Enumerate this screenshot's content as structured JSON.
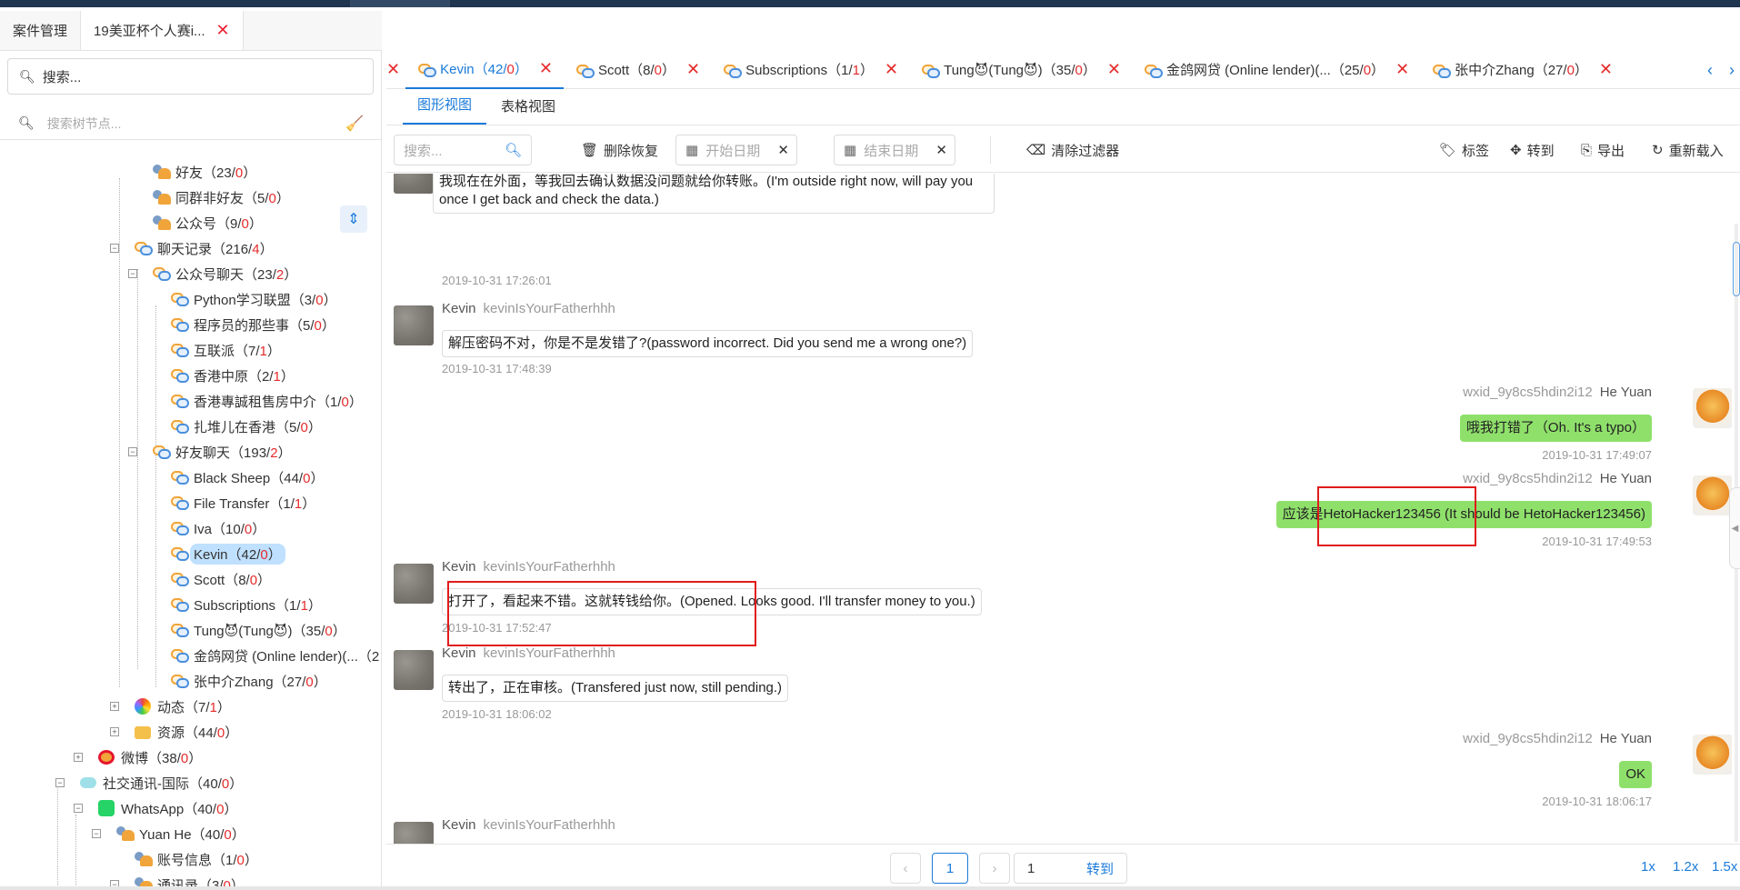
{
  "outer_tabs": [
    {
      "label": "案件管理",
      "active": false,
      "closable": false
    },
    {
      "label": "19美亚杯个人赛i...",
      "active": true,
      "closable": true
    }
  ],
  "left": {
    "search_placeholder": "搜索...",
    "tree_search_placeholder": "搜索树节点...",
    "nodes": [
      {
        "name": "好友",
        "a": "23",
        "b": "0",
        "icon": "people"
      },
      {
        "name": "同群非好友",
        "a": "5",
        "b": "0",
        "icon": "people"
      },
      {
        "name": "公众号",
        "a": "9",
        "b": "0",
        "icon": "people"
      },
      {
        "name": "聊天记录",
        "a": "216",
        "b": "4",
        "icon": "chat"
      },
      {
        "name": "公众号聊天",
        "a": "23",
        "b": "2",
        "icon": "chat"
      },
      {
        "name": "Python学习联盟",
        "a": "3",
        "b": "0",
        "icon": "chat"
      },
      {
        "name": "程序员的那些事",
        "a": "5",
        "b": "0",
        "icon": "chat"
      },
      {
        "name": "互联派",
        "a": "7",
        "b": "1",
        "icon": "chat"
      },
      {
        "name": "香港中原",
        "a": "2",
        "b": "1",
        "icon": "chat"
      },
      {
        "name": "香港專誠租售房中介",
        "a": "1",
        "b": "0",
        "icon": "chat"
      },
      {
        "name": "扎堆儿在香港",
        "a": "5",
        "b": "0",
        "icon": "chat"
      },
      {
        "name": "好友聊天",
        "a": "193",
        "b": "2",
        "icon": "chat"
      },
      {
        "name": "Black Sheep",
        "a": "44",
        "b": "0",
        "icon": "chat"
      },
      {
        "name": "File Transfer",
        "a": "1",
        "b": "1",
        "icon": "chat"
      },
      {
        "name": "Iva",
        "a": "10",
        "b": "0",
        "icon": "chat"
      },
      {
        "name": "Kevin",
        "a": "42",
        "b": "0",
        "icon": "chat"
      },
      {
        "name": "Scott",
        "a": "8",
        "b": "0",
        "icon": "chat"
      },
      {
        "name": "Subscriptions",
        "a": "1",
        "b": "1",
        "icon": "chat"
      },
      {
        "name": "Tung😈(Tung😈)",
        "a": "35",
        "b": "0",
        "icon": "chat"
      },
      {
        "name": "金鸽网贷 (Online lender)(...",
        "a": "2",
        "b": "",
        "icon": "chat"
      },
      {
        "name": "张中介Zhang",
        "a": "27",
        "b": "0",
        "icon": "chat"
      },
      {
        "name": "动态",
        "a": "7",
        "b": "1",
        "icon": "moments"
      },
      {
        "name": "资源",
        "a": "44",
        "b": "0",
        "icon": "resource"
      },
      {
        "name": "微博",
        "a": "38",
        "b": "0",
        "icon": "weibo"
      },
      {
        "name": "社交通讯-国际",
        "a": "40",
        "b": "0",
        "icon": "intl"
      },
      {
        "name": "WhatsApp",
        "a": "40",
        "b": "0",
        "icon": "whatsapp"
      },
      {
        "name": "Yuan He",
        "a": "40",
        "b": "0",
        "icon": "user"
      },
      {
        "name": "账号信息",
        "a": "1",
        "b": "0",
        "icon": "user"
      },
      {
        "name": "通讯录",
        "a": "3",
        "b": "0",
        "icon": "people"
      }
    ]
  },
  "chat_tabs": [
    {
      "name": "Kevin",
      "a": "42",
      "b": "0",
      "active": true
    },
    {
      "name": "Scott",
      "a": "8",
      "b": "0",
      "active": false
    },
    {
      "name": "Subscriptions",
      "a": "1",
      "b": "1",
      "active": false
    },
    {
      "name": "Tung😈(Tung😈)",
      "a": "35",
      "b": "0",
      "active": false
    },
    {
      "name": "金鸽网贷 (Online lender)(...",
      "a": "25",
      "b": "0",
      "active": false
    },
    {
      "name": "张中介Zhang",
      "a": "27",
      "b": "0",
      "active": false
    }
  ],
  "view_tabs": {
    "graphic": "图形视图",
    "table": "表格视图"
  },
  "toolbar": {
    "search_placeholder": "搜索...",
    "delete_restore": "删除恢复",
    "start_date": "开始日期",
    "end_date": "结束日期",
    "clear_filters": "清除过滤器",
    "tag": "标签",
    "goto": "转到",
    "export": "导出",
    "reload": "重新载入"
  },
  "messages": [
    {
      "side": "left",
      "sender": "",
      "uid": "",
      "text": "我现在在外面，等我回去确认数据没问题就给你转账。(I'm outside  right now, will pay you",
      "text2": "once I get back and check the data.)",
      "ts": "2019-10-31 17:26:01"
    },
    {
      "side": "left",
      "sender": "Kevin",
      "uid": "kevinIsYourFatherhhh",
      "text": "解压密码不对，你是不是发错了?(password incorrect. Did you send me a wrong one?)",
      "ts": "2019-10-31 17:48:39"
    },
    {
      "side": "right",
      "sender": "He Yuan",
      "uid": "wxid_9y8cs5hdin2i12",
      "text": "哦我打错了（Oh. It's a typo）",
      "ts": "2019-10-31 17:49:07"
    },
    {
      "side": "right",
      "sender": "He Yuan",
      "uid": "wxid_9y8cs5hdin2i12",
      "text": "应该是HetoHacker123456 (It should be HetoHacker123456)",
      "ts": "2019-10-31 17:49:53"
    },
    {
      "side": "left",
      "sender": "Kevin",
      "uid": "kevinIsYourFatherhhh",
      "text": "打开了，看起来不错。这就转钱给你。(Opened. Looks good. I'll transfer money  to you.)",
      "ts": "2019-10-31 17:52:47"
    },
    {
      "side": "left",
      "sender": "Kevin",
      "uid": "kevinIsYourFatherhhh",
      "text": "转出了，正在审核。(Transfered just now, still pending.)",
      "ts": "2019-10-31 18:06:02"
    },
    {
      "side": "right",
      "sender": "He Yuan",
      "uid": "wxid_9y8cs5hdin2i12",
      "text": "OK",
      "ts": "2019-10-31 18:06:17"
    },
    {
      "side": "left",
      "sender": "Kevin",
      "uid": "kevinIsYourFatherhhh",
      "text": "",
      "ts": ""
    }
  ],
  "pager": {
    "current": "1",
    "goto_value": "1",
    "goto_label": "转到",
    "zoom": [
      "1x",
      "1.2x",
      "1.5x"
    ]
  },
  "colors": {
    "accent": "#1a7ad9",
    "unread": "#e52b2b",
    "me_bubble": "#8fe06b",
    "highlight_box": "#e01b1b"
  }
}
